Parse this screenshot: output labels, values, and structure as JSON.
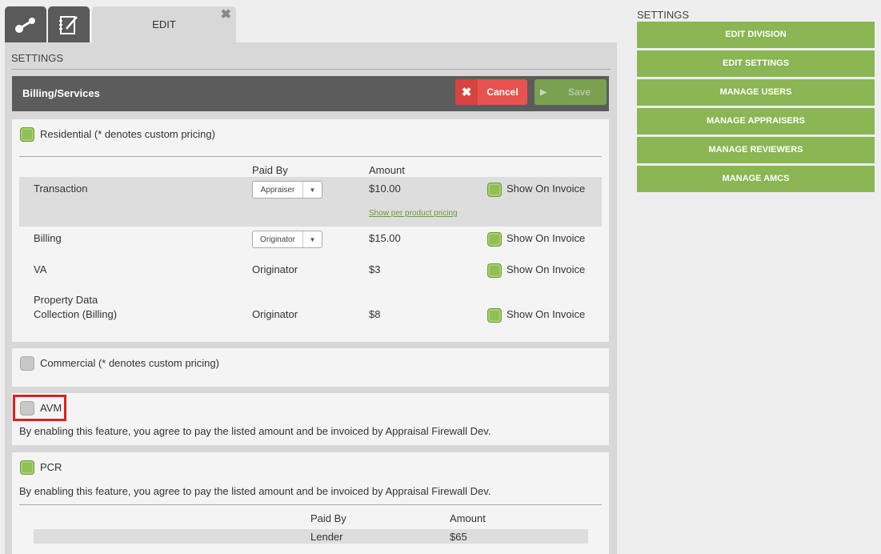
{
  "tabs": {
    "icon_tab_1": "share-icon",
    "icon_tab_2": "notebook-edit-icon",
    "edit_label": "EDIT",
    "close": "✖"
  },
  "main": {
    "heading": "SETTINGS",
    "panel_title": "Billing/Services",
    "cancel_label": "Cancel",
    "save_label": "Save"
  },
  "residential": {
    "label": "Residential (* denotes custom pricing)",
    "col_paid_by": "Paid By",
    "col_amount": "Amount",
    "rows": [
      {
        "name": "Transaction",
        "paid_by": "Appraiser",
        "amount": "$10.00",
        "invoice": "Show On Invoice",
        "link": "Show per product pricing"
      },
      {
        "name": "Billing",
        "paid_by": "Originator",
        "amount": "$15.00",
        "invoice": "Show On Invoice"
      },
      {
        "name": "VA",
        "paid_by": "Originator",
        "amount": "$3",
        "invoice": "Show On Invoice"
      },
      {
        "name_line1": "Property Data",
        "name_line2": "Collection (Billing)",
        "paid_by": "Originator",
        "amount": "$8",
        "invoice": "Show On Invoice"
      }
    ]
  },
  "commercial": {
    "label": "Commercial (* denotes custom pricing)"
  },
  "avm": {
    "label": "AVM",
    "notice": "By enabling this feature, you agree to pay the listed amount and be invoiced by Appraisal Firewall Dev."
  },
  "pcr": {
    "label": "PCR",
    "notice": "By enabling this feature, you agree to pay the listed amount and be invoiced by Appraisal Firewall Dev.",
    "col_paid_by": "Paid By",
    "col_amount": "Amount",
    "paid_by": "Lender",
    "amount": "$65"
  },
  "sidebar": {
    "heading": "SETTINGS",
    "buttons": [
      "EDIT DIVISION",
      "EDIT SETTINGS",
      "MANAGE USERS",
      "MANAGE APPRAISERS",
      "MANAGE REVIEWERS",
      "MANAGE AMCS"
    ]
  },
  "colors": {
    "accent_green": "#8ab653",
    "cancel_red": "#e8534f",
    "highlight_box": "#e02020"
  }
}
